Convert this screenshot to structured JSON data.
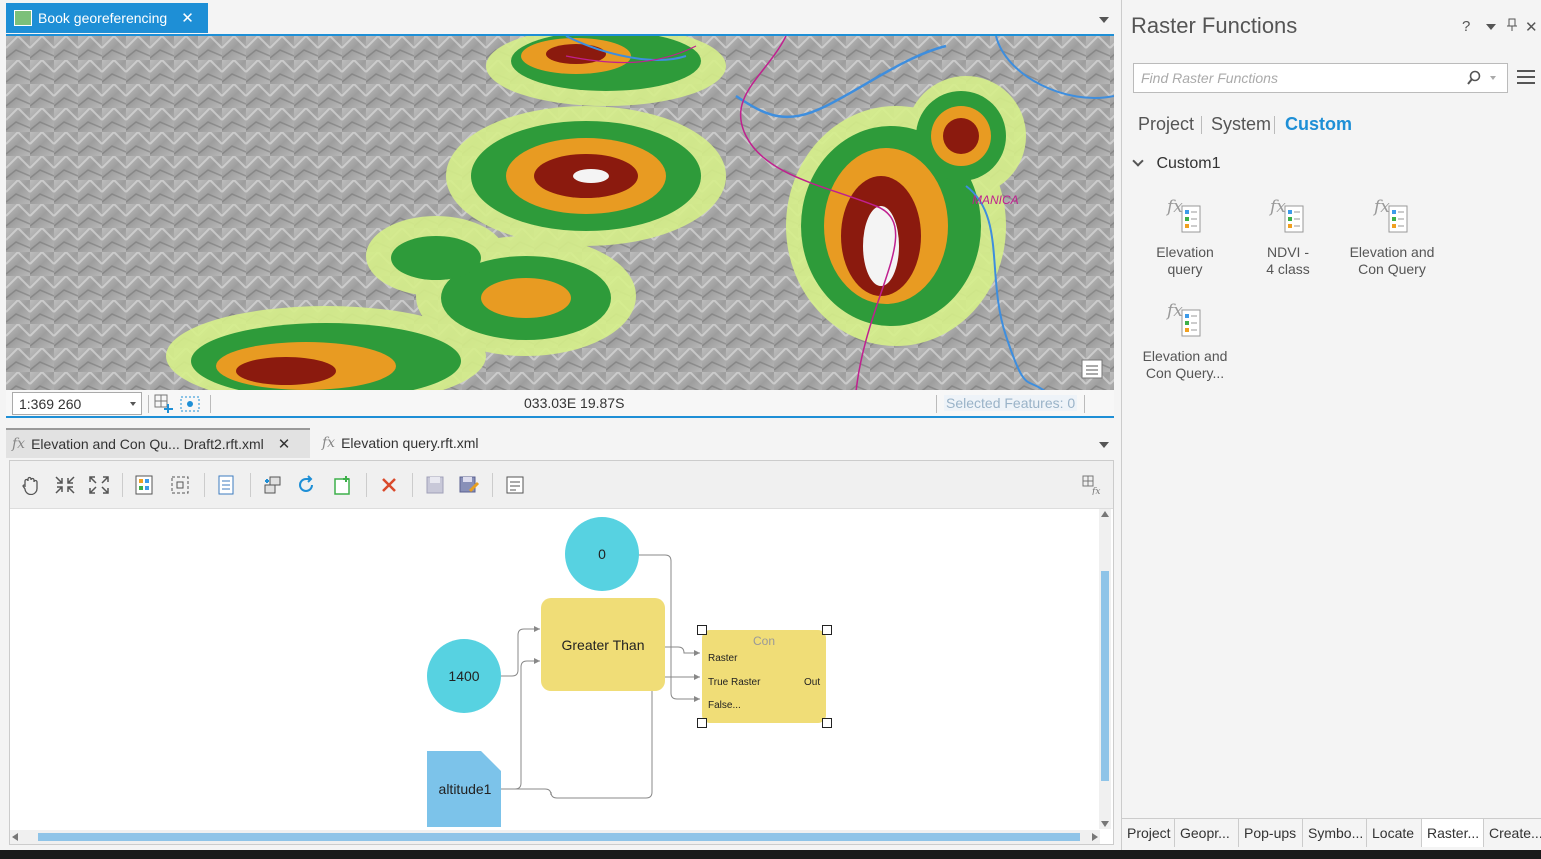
{
  "map_tab": {
    "title": "Book georeferencing",
    "close": "✕"
  },
  "map_status": {
    "scale": "1:369 260",
    "coords": "033.03E 19.87S",
    "selected": "Selected Features: 0"
  },
  "map_label": "MANICA",
  "mb_tabs": [
    {
      "label": "Elevation and Con Qu... Draft2.rft.xml",
      "close": "✕"
    },
    {
      "label": "Elevation query.rft.xml"
    }
  ],
  "model": {
    "zero": "0",
    "value1400": "1400",
    "greater_than": "Greater Than",
    "altitude": "altitude1",
    "con": {
      "title": "Con",
      "raster": "Raster",
      "true_raster": "True Raster",
      "false": "False...",
      "out": "Out"
    }
  },
  "panel": {
    "title": "Raster Functions",
    "help": "?",
    "close": "✕",
    "search_placeholder": "Find Raster Functions",
    "tabs": [
      "Project",
      "System",
      "Custom"
    ],
    "group": "Custom1",
    "functions": [
      {
        "line1": "Elevation",
        "line2": "query"
      },
      {
        "line1": "NDVI -",
        "line2": "4 class"
      },
      {
        "line1": "Elevation and",
        "line2": "Con Query"
      },
      {
        "line1": "Elevation and",
        "line2": "Con Query..."
      }
    ],
    "bottom_tabs": [
      "Project",
      "Geopr...",
      "Pop-ups",
      "Symbo...",
      "Locate",
      "Raster...",
      "Create..."
    ]
  },
  "colors": {
    "accent": "#1e8fd6",
    "node_cyan": "#57d2e1",
    "node_yellow": "#f0dd77",
    "data_blue": "#7cc3ea"
  }
}
